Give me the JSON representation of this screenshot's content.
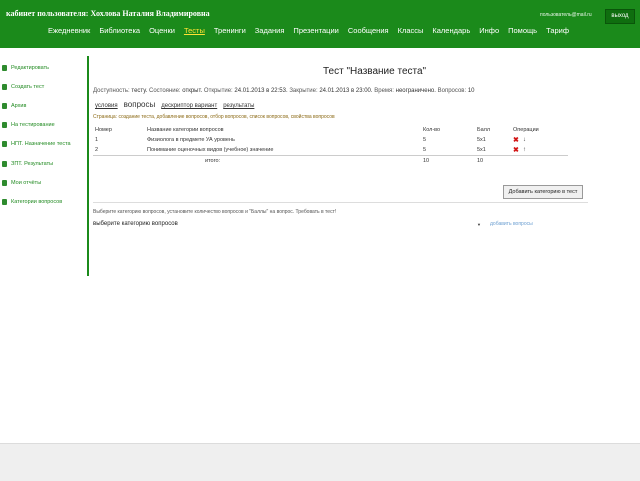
{
  "header": {
    "cabinet_title": "кабинет пользователя: Хохлова Наталия Владимировна",
    "user_email": "пользователь@mail.ru",
    "logout_label": "выход"
  },
  "main_nav": [
    {
      "label": "Ежедневник",
      "active": false
    },
    {
      "label": "Библиотека",
      "active": false
    },
    {
      "label": "Оценки",
      "active": false
    },
    {
      "label": "Тесты",
      "active": true
    },
    {
      "label": "Тренинги",
      "active": false
    },
    {
      "label": "Задания",
      "active": false
    },
    {
      "label": "Презентации",
      "active": false
    },
    {
      "label": "Сообщения",
      "active": false
    },
    {
      "label": "Классы",
      "active": false
    },
    {
      "label": "Календарь",
      "active": false
    },
    {
      "label": "Инфо",
      "active": false
    },
    {
      "label": "Помощь",
      "active": false
    },
    {
      "label": "Тариф",
      "active": false
    }
  ],
  "sidebar": [
    {
      "label": "Редактировать"
    },
    {
      "label": "Создать тест"
    },
    {
      "label": "Архив"
    },
    {
      "label": "На тестирование"
    },
    {
      "label": "НПТ. Назначение теста"
    },
    {
      "label": "ЗПТ. Результаты"
    },
    {
      "label": "Мои отчёты"
    },
    {
      "label": "Категории вопросов"
    }
  ],
  "test": {
    "title": "Тест \"Название теста\"",
    "info": {
      "access_label": "Доступность:",
      "access_value": "тесту",
      "state_label": "Состояние:",
      "state_value": "открыт",
      "open_label": "Открытие:",
      "open_value": "24.01.2013 в 22:53",
      "close_label": "Закрытие:",
      "close_value": "24.01.2013 в 23:00",
      "time_label": "Время:",
      "time_value": "неограничено",
      "questions_label": "Вопросов:",
      "questions_value": "10"
    },
    "subtabs": {
      "conditions": "условия",
      "questions": "вопросы",
      "variant": "дескриптор вариант",
      "results": "результаты"
    },
    "hint": "Страница: создание теста, добавление вопросов, отбор вопросов, список вопросов, свойства вопросов",
    "table_headers": {
      "num": "Номер",
      "category": "Название категории вопросов",
      "count": "Кол-во",
      "score": "Балл",
      "ops": "Операции"
    },
    "rows": [
      {
        "num": "1",
        "category": "Физиолога в предмете УА уровень",
        "count": "5",
        "score": "5x1"
      },
      {
        "num": "2",
        "category": "Понимание оценочных видов (учебное) значение",
        "count": "5",
        "score": "5x1"
      }
    ],
    "total": {
      "label": "итого:",
      "count": "10",
      "score": "10"
    },
    "add_button": "Добавить категорию в тест",
    "select_note": "Выберите категорию вопросов, установите количество вопросов и \"Баллы\" на вопрос. Требовать в тест!",
    "select_value": "выберите категорию вопросов",
    "add_question_link": "добавить вопросы"
  }
}
